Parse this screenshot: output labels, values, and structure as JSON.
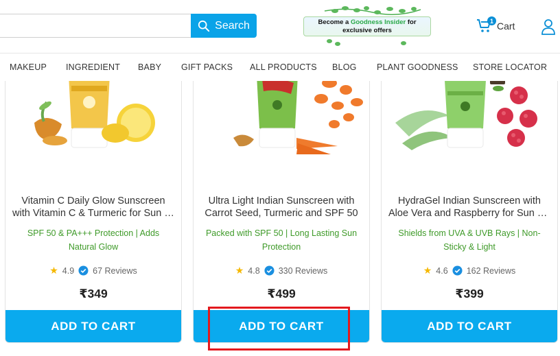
{
  "search": {
    "placeholder": "",
    "button_label": "Search"
  },
  "promo": {
    "prefix": "Become a ",
    "highlight": "Goodness Insider",
    "suffix": " for",
    "line2": "exclusive offers"
  },
  "cart": {
    "label": "Cart",
    "count": "1"
  },
  "nav": [
    "MAKEUP",
    "INGREDIENT",
    "BABY",
    "GIFT PACKS",
    "ALL PRODUCTS",
    "BLOG",
    "PLANT GOODNESS",
    "STORE LOCATOR"
  ],
  "products": [
    {
      "title_line1": "Vitamin C Daily Glow Sunscreen",
      "title_line2": "with Vitamin C & Turmeric for Sun Protection",
      "tagline": "SPF 50 & PA+++ Protection | Adds Natural Glow",
      "rating": "4.9",
      "reviews": "67 Reviews",
      "price": "₹349",
      "button": "ADD TO CART",
      "tube_color": "#f3c64a",
      "cap_color": "#ffffff"
    },
    {
      "title_line1": "Ultra Light Indian Sunscreen with",
      "title_line2": "Carrot Seed, Turmeric and SPF 50",
      "tagline": "Packed with SPF 50 | Long Lasting Sun Protection",
      "rating": "4.8",
      "reviews": "330 Reviews",
      "price": "₹499",
      "button": "ADD TO CART",
      "tube_color": "#7cbf4a",
      "cap_color": "#ffffff"
    },
    {
      "title_line1": "HydraGel Indian Sunscreen with",
      "title_line2": "Aloe Vera and Raspberry for Sun Protection",
      "tagline": "Shields from UVA & UVB Rays | Non-Sticky & Light",
      "rating": "4.6",
      "reviews": "162 Reviews",
      "price": "₹399",
      "button": "ADD TO CART",
      "tube_color": "#8ed06a",
      "cap_color": "#ffffff"
    }
  ],
  "colors": {
    "primary": "#0aaaee",
    "tagline_green": "#3e9a28",
    "highlight_red": "#e3191e"
  }
}
